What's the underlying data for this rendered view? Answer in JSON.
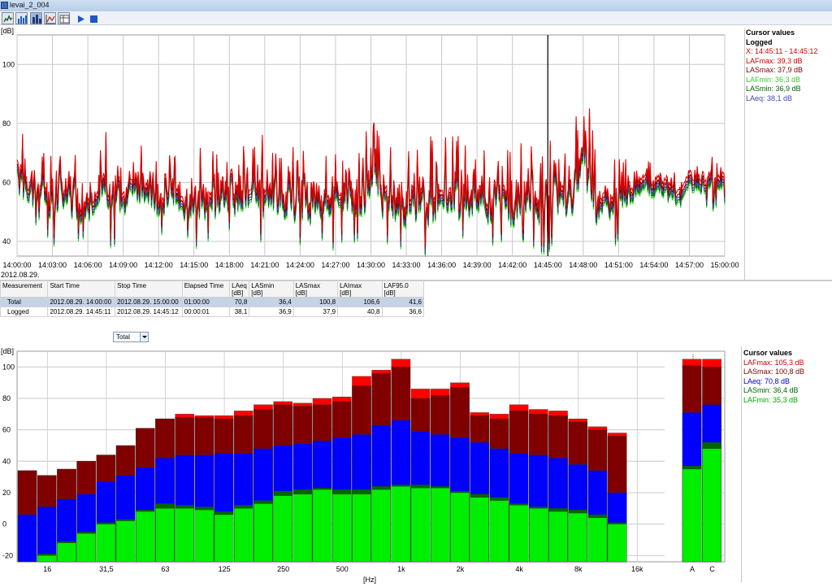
{
  "window": {
    "title": "levai_2_004"
  },
  "colors": {
    "dark_red": "#800000",
    "red": "#ff0000",
    "blue": "#0000ff",
    "dark_green": "#006600",
    "green": "#00ee00",
    "lavender": "#6666cc",
    "grid": "#c8c8c8"
  },
  "toolbar": {
    "icons": [
      "time-history-icon",
      "spectrum-icon",
      "bar-chart-icon",
      "statistics-icon",
      "table-icon",
      "play-icon",
      "stop-icon"
    ]
  },
  "top_chart": {
    "unit_label": "[dB]",
    "date_label": "2012.08.29.",
    "cursor_time_label": "14:45:00",
    "y_ticks": [
      "100",
      "80",
      "60",
      "40"
    ],
    "x_ticks": [
      "14:00:00",
      "14:03:00",
      "14:06:00",
      "14:09:00",
      "14:12:00",
      "14:15:00",
      "14:18:00",
      "14:21:00",
      "14:24:00",
      "14:27:00",
      "14:30:00",
      "14:33:00",
      "14:36:00",
      "14:39:00",
      "14:42:00",
      "14:45:00",
      "14:48:00",
      "14:51:00",
      "14:54:00",
      "14:57:00",
      "15:00:00"
    ],
    "cursor_panel": {
      "heading": "Cursor values",
      "subheading": "Logged",
      "lines": [
        {
          "text": "X: 14:45:11 - 14:45:12",
          "color": "#cc0000"
        },
        {
          "text": "LAFmax: 39,3 dB",
          "color": "#cc0000"
        },
        {
          "text": "LASmax: 37,9 dB",
          "color": "#800000"
        },
        {
          "text": "LAFmin: 36,3 dB",
          "color": "#33cc33"
        },
        {
          "text": "LASmin: 36,9 dB",
          "color": "#006600"
        },
        {
          "text": "LAeq: 38,1 dB",
          "color": "#4444bb"
        }
      ]
    }
  },
  "table": {
    "headers": [
      {
        "l1": "Measurement",
        "l2": ""
      },
      {
        "l1": "Start Time",
        "l2": ""
      },
      {
        "l1": "Stop Time",
        "l2": ""
      },
      {
        "l1": "Elapsed Time",
        "l2": ""
      },
      {
        "l1": "LAeq",
        "l2": "[dB]"
      },
      {
        "l1": "LASmin",
        "l2": "[dB]"
      },
      {
        "l1": "LASmax",
        "l2": "[dB]"
      },
      {
        "l1": "LAImax",
        "l2": "[dB]"
      },
      {
        "l1": "LAF95.0",
        "l2": "[dB]"
      }
    ],
    "rows": [
      {
        "cells": [
          "Total",
          "2012.08.29. 14:00:00",
          "2012.08.29. 15:00:00",
          "01:00:00",
          "70,8",
          "36,4",
          "100,8",
          "106,6",
          "41,6"
        ]
      },
      {
        "cells": [
          "Logged",
          "2012.08.29. 14:45:11",
          "2012.08.29. 14:45:12",
          "00:00:01",
          "38,1",
          "36,9",
          "37,9",
          "40,8",
          "36,6"
        ]
      }
    ],
    "selector_value": "Total"
  },
  "bottom_chart": {
    "unit_label": "[dB]",
    "x_axis_label": "[Hz]",
    "cursor_panel": {
      "heading": "Cursor values",
      "lines": [
        {
          "text": "LAFmax: 105,3 dB",
          "color": "#cc0000"
        },
        {
          "text": "LASmax: 100,8 dB",
          "color": "#800000"
        },
        {
          "text": "LAeq: 70,8 dB",
          "color": "#0000cc"
        },
        {
          "text": "LASmin: 36,4 dB",
          "color": "#006600"
        },
        {
          "text": "LAFmin: 35,3 dB",
          "color": "#00aa00"
        }
      ]
    }
  },
  "chart_data": [
    {
      "type": "line",
      "xlabel": "",
      "ylabel": "[dB]",
      "x_range": [
        "14:00:00",
        "15:00:00"
      ],
      "ylim": [
        35,
        110
      ],
      "grid": true,
      "cursor_at": "14:45:00",
      "series": [
        {
          "name": "LAFmax",
          "color": "#dd0000"
        },
        {
          "name": "LASmax",
          "color": "#800000"
        },
        {
          "name": "LAeq",
          "color": "#4444bb"
        },
        {
          "name": "LASmin",
          "color": "#006600"
        },
        {
          "name": "LAFmin",
          "color": "#33cc33"
        }
      ],
      "x_minutes": [
        0,
        1,
        2,
        3,
        4,
        5,
        6,
        7,
        8,
        9,
        10,
        11,
        12,
        13,
        14,
        15,
        16,
        17,
        18,
        19,
        20,
        21,
        22,
        23,
        24,
        25,
        26,
        27,
        28,
        29,
        30,
        31,
        32,
        33,
        34,
        35,
        36,
        37,
        38,
        39,
        40,
        41,
        42,
        43,
        44,
        45,
        46,
        47,
        48,
        49,
        50,
        51,
        52,
        53,
        54,
        55,
        56,
        57,
        58,
        59,
        60
      ],
      "LAFmax_envelope": [
        80,
        76,
        72,
        70,
        72,
        70,
        62,
        70,
        85,
        72,
        70,
        75,
        66,
        75,
        60,
        74,
        70,
        72,
        66,
        75,
        74,
        78,
        70,
        73,
        74,
        72,
        70,
        78,
        74,
        72,
        82,
        76,
        70,
        74,
        72,
        76,
        74,
        78,
        74,
        75,
        72,
        74,
        70,
        76,
        74,
        78,
        68,
        74,
        102,
        74,
        70,
        70,
        68,
        70,
        68,
        66,
        64,
        68,
        66,
        70,
        72
      ],
      "LAFmin_envelope": [
        52,
        46,
        50,
        42,
        44,
        42,
        46,
        48,
        40,
        45,
        52,
        48,
        44,
        46,
        48,
        40,
        44,
        44,
        46,
        45,
        46,
        40,
        44,
        41,
        41,
        40,
        44,
        40,
        44,
        42,
        44,
        40,
        44,
        38,
        40,
        38,
        42,
        40,
        44,
        42,
        40,
        44,
        40,
        44,
        40,
        38,
        48,
        40,
        50,
        40,
        44,
        42,
        50,
        56,
        54,
        56,
        52,
        58,
        56,
        54,
        56
      ]
    },
    {
      "type": "bar",
      "title": "",
      "xlabel": "[Hz]",
      "ylabel": "[dB]",
      "ylim": [
        -24,
        110
      ],
      "y_ticks": [
        100,
        80,
        60,
        40,
        20,
        0,
        -20
      ],
      "x_tick_labels": [
        "16",
        "31,5",
        "63",
        "125",
        "250",
        "500",
        "1k",
        "2k",
        "4k",
        "8k",
        "16k",
        "A",
        "C"
      ],
      "grid": true,
      "categories": [
        "12.5",
        "16",
        "20",
        "25",
        "31.5",
        "40",
        "50",
        "63",
        "80",
        "100",
        "125",
        "160",
        "200",
        "250",
        "315",
        "400",
        "500",
        "630",
        "800",
        "1k",
        "1.25k",
        "1.6k",
        "2k",
        "2.5k",
        "3.15k",
        "4k",
        "5k",
        "6.3k",
        "8k",
        "10k",
        "12.5k",
        "16k",
        "20k",
        "A",
        "C"
      ],
      "series": [
        {
          "name": "LAFmax",
          "color": "#ff0000",
          "values": [
            34,
            31,
            35,
            40,
            44,
            50,
            61,
            67,
            70,
            69,
            69,
            72,
            76,
            78,
            77,
            80,
            81,
            94,
            98,
            105,
            86,
            86,
            90,
            71,
            70,
            76,
            73,
            72,
            67,
            62,
            58,
            0,
            0,
            105,
            105
          ]
        },
        {
          "name": "LASmax",
          "color": "#800000",
          "values": [
            34,
            31,
            35,
            40,
            44,
            50,
            61,
            67,
            68,
            68,
            67,
            69,
            73,
            76,
            75,
            76,
            78,
            88,
            96,
            100,
            80,
            82,
            87,
            69,
            67,
            72,
            70,
            69,
            65,
            60,
            56,
            0,
            0,
            101,
            100
          ]
        },
        {
          "name": "LAeq",
          "color": "#0000ff",
          "values": [
            6,
            11,
            16,
            19,
            27,
            31,
            36,
            42,
            44,
            44,
            45,
            45,
            48,
            50,
            51,
            53,
            55,
            57,
            63,
            66,
            59,
            57,
            55,
            52,
            48,
            45,
            44,
            42,
            38,
            34,
            20,
            0,
            0,
            71,
            76
          ]
        },
        {
          "name": "LASmin",
          "color": "#006600",
          "values": [
            -24,
            -19,
            -11,
            -5,
            1,
            3,
            9,
            13,
            12,
            11,
            8,
            12,
            15,
            21,
            22,
            23,
            22,
            22,
            24,
            25,
            25,
            24,
            21,
            19,
            17,
            13,
            11,
            10,
            9,
            6,
            1,
            0,
            0,
            37,
            52
          ]
        },
        {
          "name": "LAFmin",
          "color": "#00ee00",
          "values": [
            -24,
            -20,
            -12,
            -6,
            0,
            2,
            8,
            10,
            10,
            9,
            6,
            10,
            13,
            18,
            19,
            22,
            19,
            19,
            22,
            24,
            23,
            23,
            20,
            17,
            15,
            12,
            10,
            8,
            7,
            4,
            0,
            0,
            0,
            35,
            48
          ]
        }
      ]
    }
  ]
}
